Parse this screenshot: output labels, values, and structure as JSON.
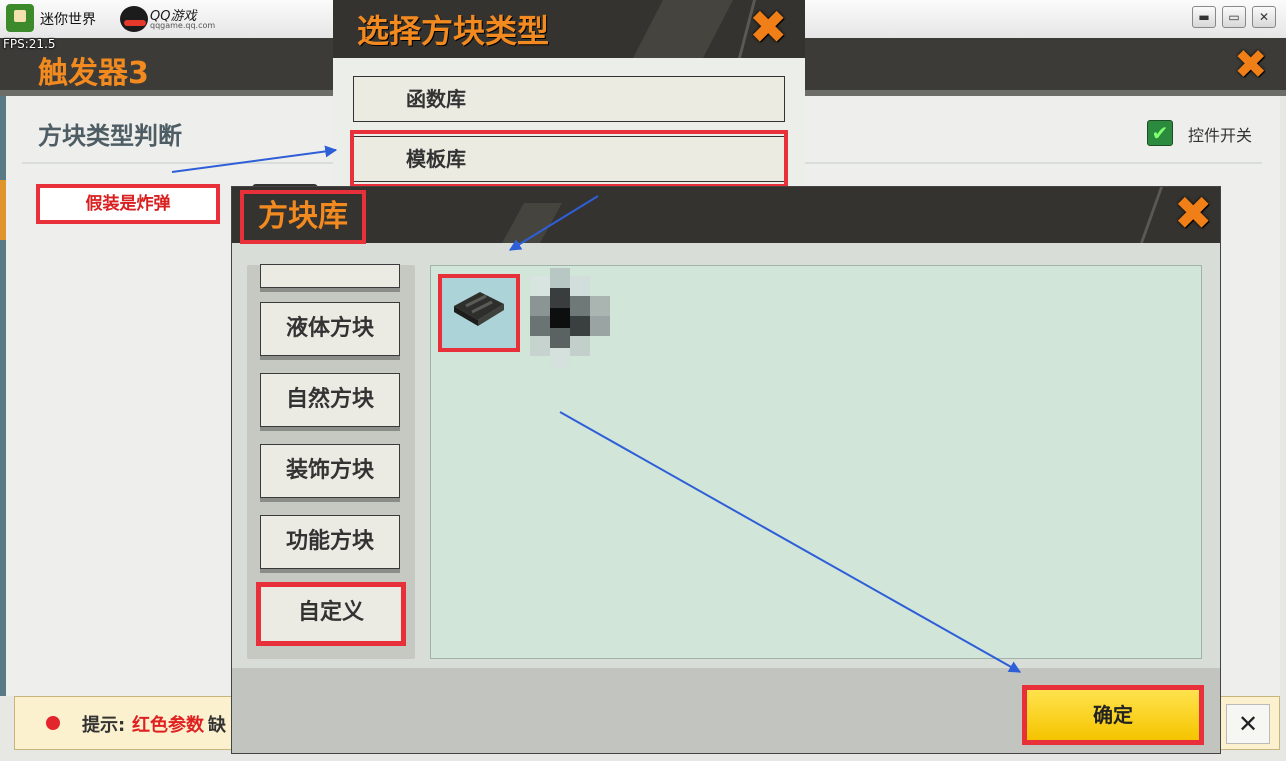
{
  "titlebar": {
    "app_name": "迷你世界",
    "qq_text": "QQ游戏",
    "qq_sub": "qqgame.qq.com",
    "minimize": "▬",
    "maximize": "▭",
    "close": "✕"
  },
  "fps": "FPS:21.5",
  "trigger_window": {
    "title": "触发器3",
    "close": "✖",
    "section_title": "方块类型判断",
    "fake_bomb_label": "假装是炸弹",
    "toggle_label": "控件开关",
    "toggle_checked": true,
    "hint": {
      "label": "提示:",
      "red_text": "红色参数",
      "rest_text": "缺"
    },
    "hint_close": "✕"
  },
  "choose_dialog": {
    "title": "选择方块类型",
    "close": "✖",
    "options": [
      "函数库",
      "模板库"
    ]
  },
  "library_dialog": {
    "title": "方块库",
    "close": "✖",
    "categories": [
      "液体方块",
      "自然方块",
      "装饰方块",
      "功能方块",
      "自定义"
    ],
    "confirm_label": "确定"
  },
  "colors": {
    "accent_orange": "#f38a1f",
    "highlight_red": "#e8303a",
    "arrow_blue": "#2f5fd8",
    "confirm_yellow": "#ffd81a"
  },
  "icons": [
    "game-logo-icon",
    "qq-game-logo-icon",
    "close-x-icon",
    "checkbox-check-icon",
    "block-item-icon"
  ]
}
